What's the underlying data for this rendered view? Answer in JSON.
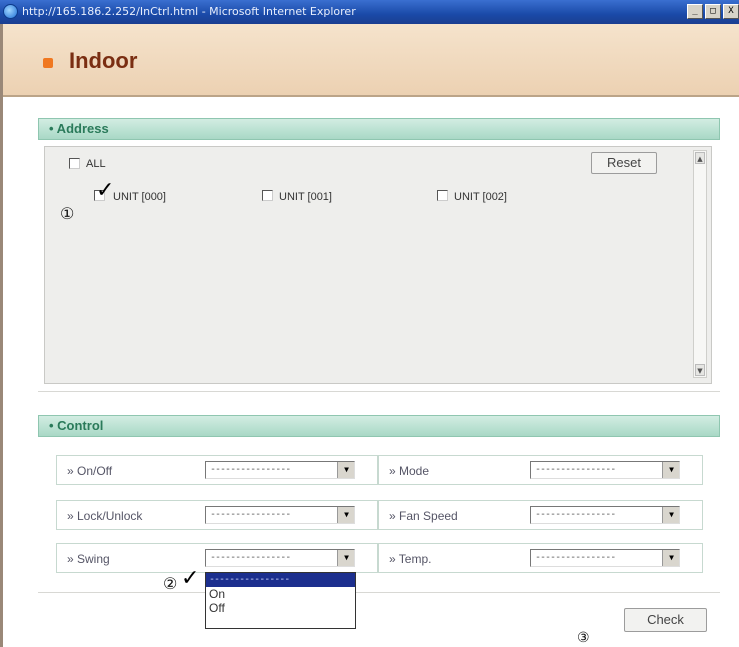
{
  "window": {
    "title": "http://165.186.2.252/InCtrl.html - Microsoft Internet Explorer",
    "buttons": [
      "_",
      "□",
      "X"
    ]
  },
  "header": {
    "title": "Indoor"
  },
  "address": {
    "section_label": "• Address",
    "all_label": "ALL",
    "reset_label": "Reset",
    "units": [
      {
        "label": "UNIT [000]",
        "checked": true
      },
      {
        "label": "UNIT [001]",
        "checked": false
      },
      {
        "label": "UNIT [002]",
        "checked": false
      }
    ],
    "marker": "①",
    "checkmark": "✓"
  },
  "control": {
    "section_label": "• Control",
    "rows": [
      {
        "label": "» On/Off",
        "value": "----------------"
      },
      {
        "label": "» Mode",
        "value": "----------------"
      },
      {
        "label": "» Lock/Unlock",
        "value": "----------------"
      },
      {
        "label": "» Fan Speed",
        "value": "----------------"
      },
      {
        "label": "» Swing",
        "value": "----------------"
      },
      {
        "label": "» Temp.",
        "value": "----------------"
      }
    ],
    "dropdown_options": [
      "----------------",
      "On",
      "Off"
    ],
    "marker": "②",
    "checkmark": "✓",
    "check_label": "Check",
    "check_marker": "③"
  },
  "icons": {
    "dropdown_arrow": "▼",
    "scroll_up": "▲",
    "scroll_down": "▼"
  }
}
